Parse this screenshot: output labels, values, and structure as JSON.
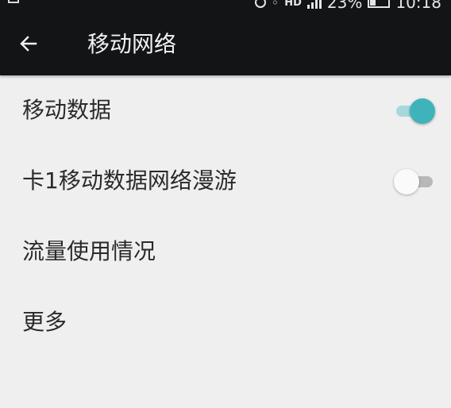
{
  "status_bar": {
    "network": "HD",
    "battery": "23%",
    "time": "10:18"
  },
  "toolbar": {
    "title": "移动网络",
    "back_icon": "arrow-back-icon"
  },
  "settings": [
    {
      "label": "移动数据",
      "toggle": true,
      "state": "on"
    },
    {
      "label": "卡1移动数据网络漫游",
      "toggle": true,
      "state": "off"
    },
    {
      "label": "流量使用情况",
      "toggle": false
    },
    {
      "label": "更多",
      "toggle": false
    }
  ],
  "colors": {
    "toolbar_bg": "#121416",
    "page_bg": "#efefef",
    "accent": "#3fb3ba",
    "accent_track": "#a6d9dc",
    "switch_off_thumb": "#fafafa",
    "switch_off_track": "#b8b8b8"
  }
}
